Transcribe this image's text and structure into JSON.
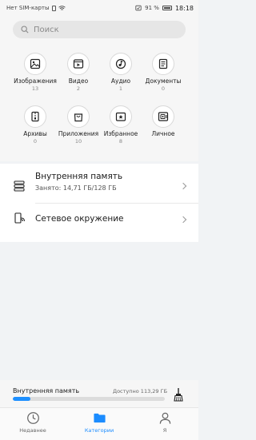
{
  "status_bar": {
    "carrier": "Нет SIM-карты",
    "battery": "91 %",
    "time": "18:18"
  },
  "search": {
    "placeholder": "Поиск"
  },
  "categories": [
    {
      "label": "Изображения",
      "count": "13",
      "icon": "image-icon"
    },
    {
      "label": "Видео",
      "count": "2",
      "icon": "video-icon"
    },
    {
      "label": "Аудио",
      "count": "1",
      "icon": "audio-icon"
    },
    {
      "label": "Документы",
      "count": "0",
      "icon": "document-icon"
    },
    {
      "label": "Архивы",
      "count": "0",
      "icon": "archive-icon"
    },
    {
      "label": "Приложения",
      "count": "10",
      "icon": "app-bag-icon"
    },
    {
      "label": "Избранное",
      "count": "8",
      "icon": "star-folder-icon"
    },
    {
      "label": "Личное",
      "count": "",
      "icon": "safe-icon"
    }
  ],
  "storage": {
    "internal_title": "Внутренняя память",
    "internal_used": "Занято: 14,71 ГБ/128 ГБ",
    "network_title": "Сетевое окружение"
  },
  "bottom_storage": {
    "label": "Внутренняя память",
    "free": "Доступно 113,29 ГБ",
    "used_fraction": 0.115
  },
  "nav": {
    "recent": "Недавнее",
    "categories": "Категории",
    "me": "Я"
  },
  "colors": {
    "accent": "#1e90ff"
  }
}
